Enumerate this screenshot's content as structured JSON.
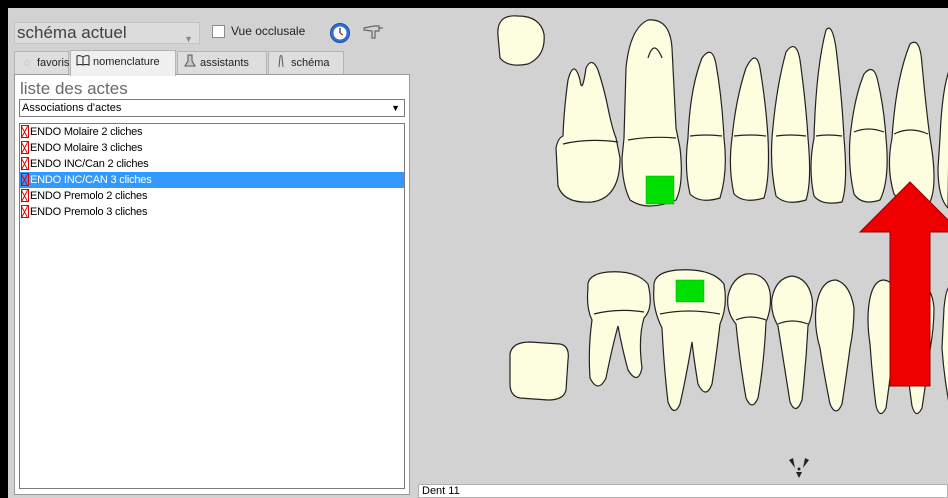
{
  "toolbar": {
    "schema_value": "schéma actuel",
    "vue_occlusale_label": "Vue occlusale",
    "vue_occlusale_checked": false
  },
  "tabs": [
    {
      "label": "favoris",
      "icon": "star-icon",
      "active": false
    },
    {
      "label": "nomenclature",
      "icon": "book-icon",
      "active": true
    },
    {
      "label": "assistants",
      "icon": "wizard-icon",
      "active": false
    },
    {
      "label": "schéma",
      "icon": "tooth-icon",
      "active": false
    }
  ],
  "panel": {
    "title": "liste des actes",
    "category_value": "Associations d'actes",
    "items": [
      {
        "label": "ENDO Molaire 2 cliches",
        "selected": false
      },
      {
        "label": "ENDO Molaire 3 cliches",
        "selected": false
      },
      {
        "label": "ENDO INC/Can 2 cliches",
        "selected": false
      },
      {
        "label": "ENDO INC/CAN 3 cliches",
        "selected": true
      },
      {
        "label": "ENDO Premolo 2 cliches",
        "selected": false
      },
      {
        "label": "ENDO Premolo 3 cliches",
        "selected": false
      }
    ]
  },
  "status": {
    "text": "Dent 11"
  },
  "colors": {
    "tooth_fill": "#fdfde0",
    "marker_green": "#00e000",
    "arrow_red": "#ee0000",
    "selection": "#3399ff"
  }
}
